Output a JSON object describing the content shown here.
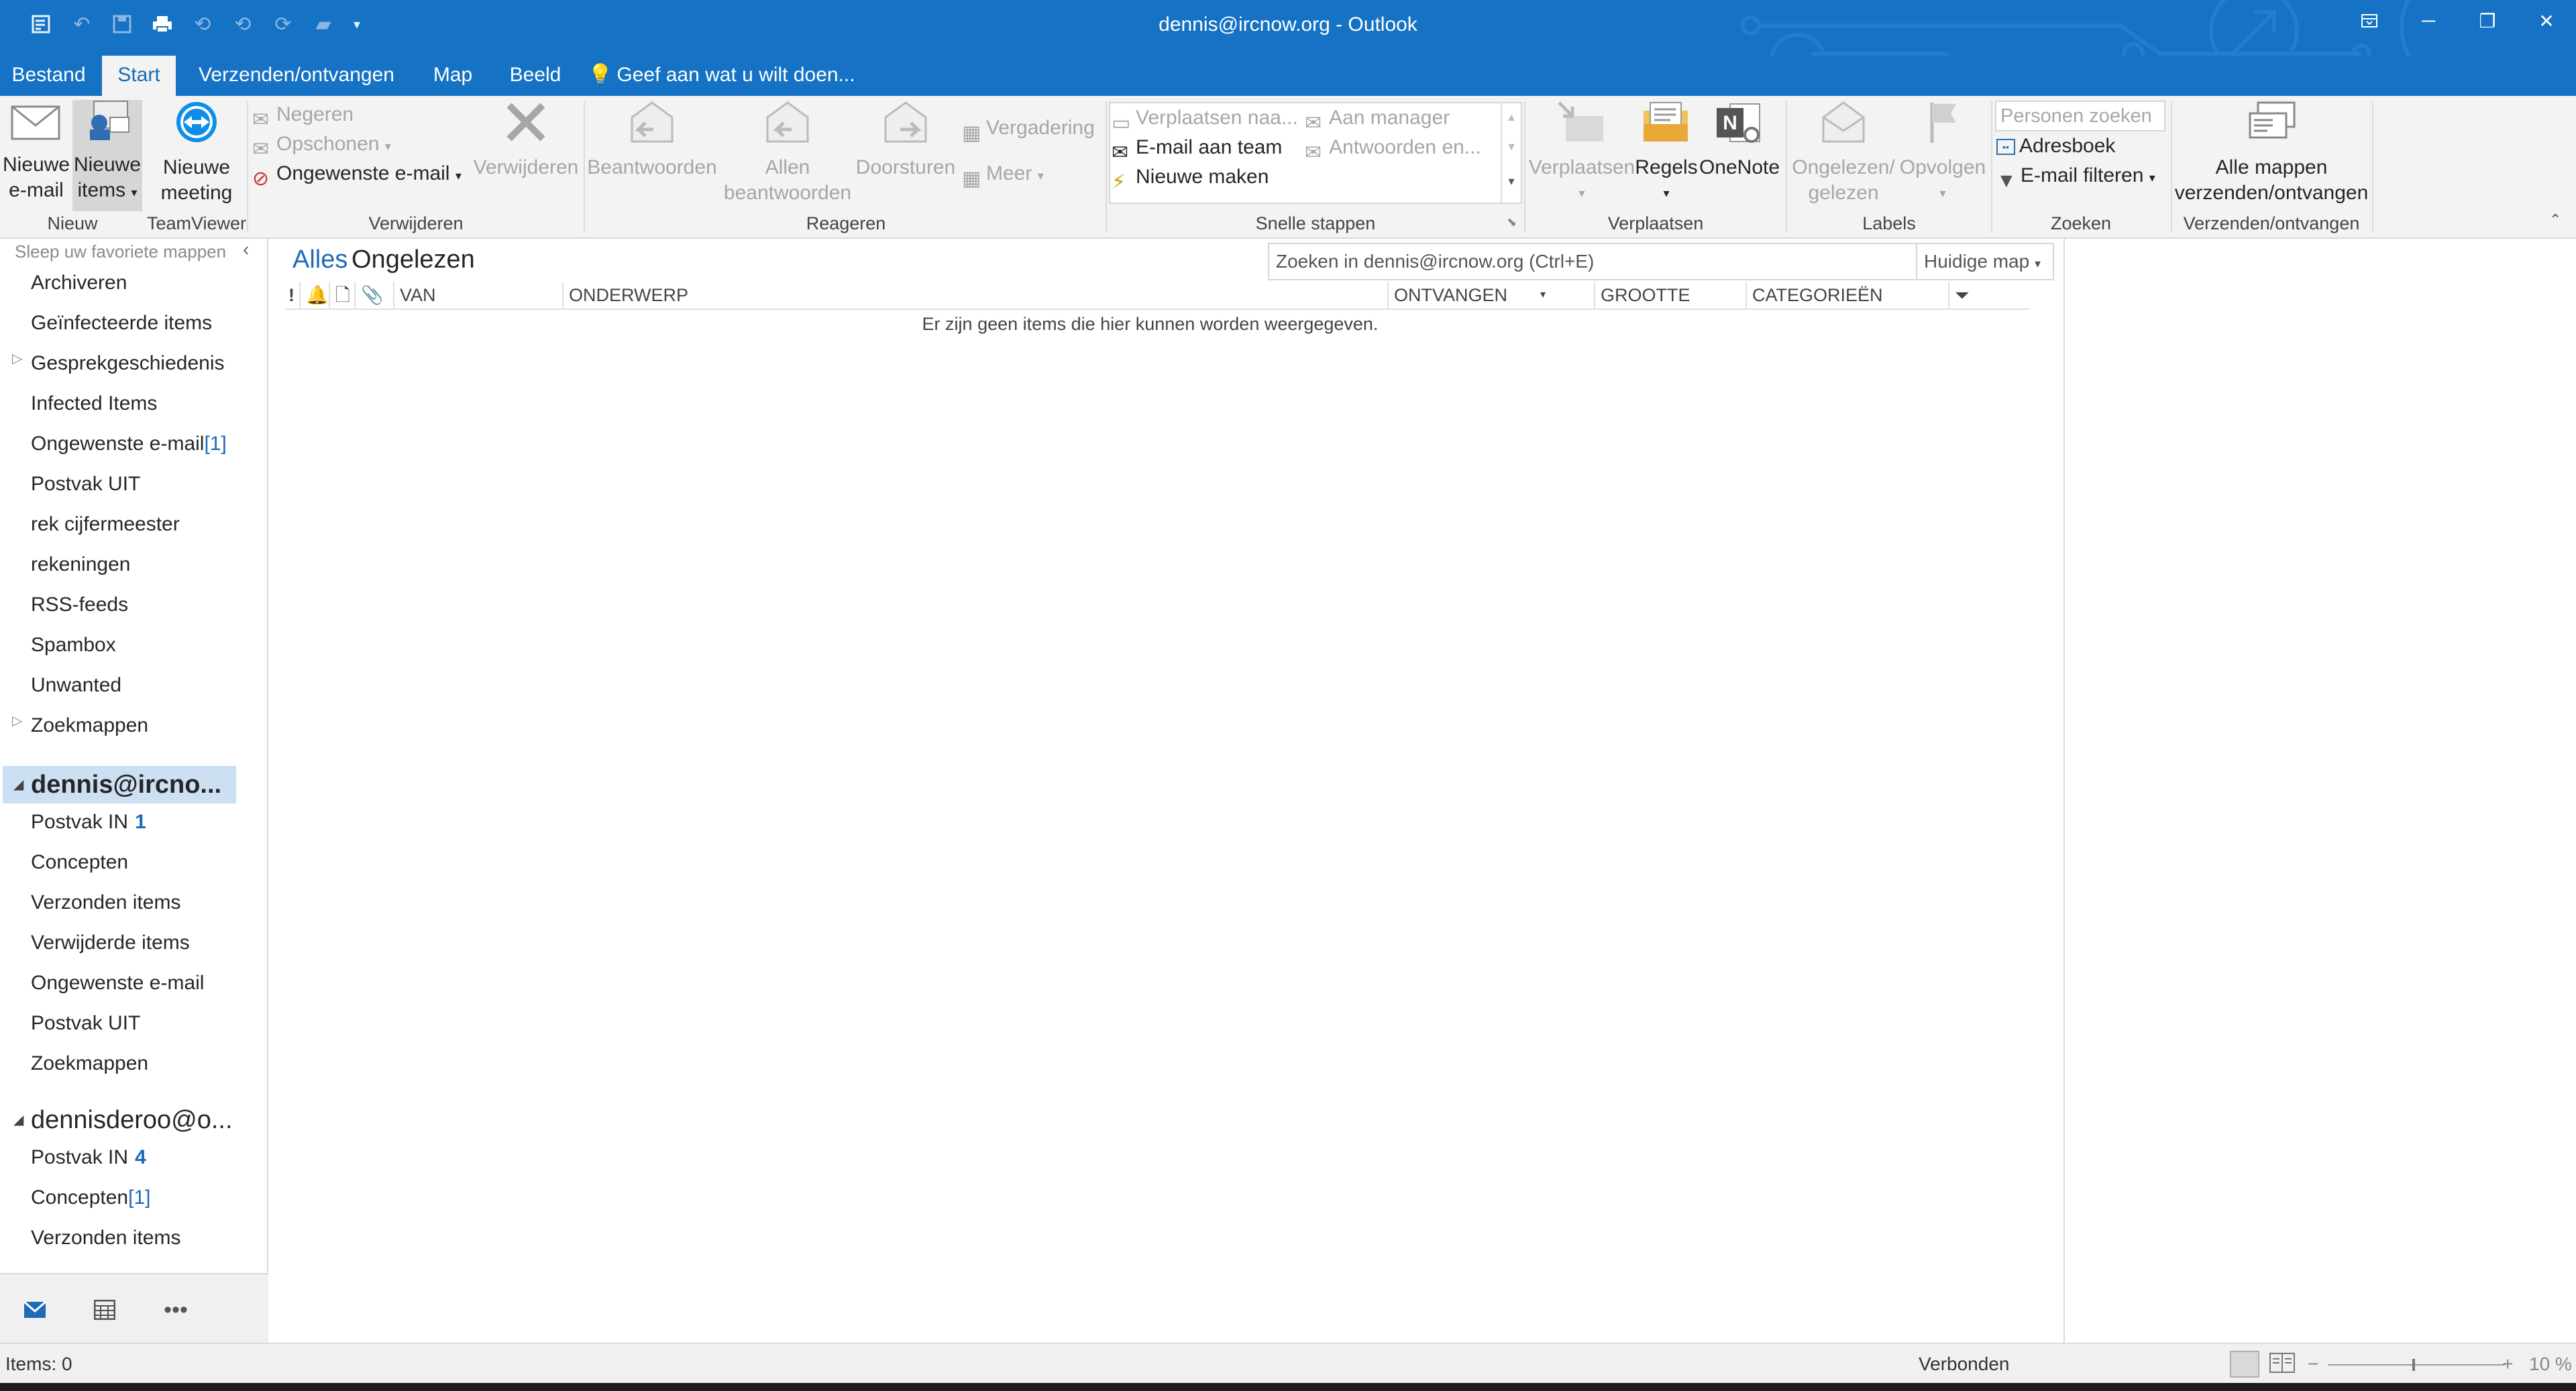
{
  "window": {
    "title": "dennis@ircnow.org - Outlook",
    "accent": "#1572c4"
  },
  "ribbon_tabs": [
    "Bestand",
    "Start",
    "Verzenden/ontvangen",
    "Map",
    "Beeld"
  ],
  "active_tab": "Start",
  "tell_me": "Geef aan wat u wilt doen...",
  "ribbon": {
    "nieuw": {
      "label": "Nieuw",
      "new_email": [
        "Nieuwe",
        "e-mail"
      ],
      "new_items": [
        "Nieuwe",
        "items"
      ]
    },
    "teamviewer": {
      "label": "TeamViewer",
      "new_meeting": [
        "Nieuwe",
        "meeting"
      ]
    },
    "verwijderen": {
      "label": "Verwijderen",
      "ignore": "Negeren",
      "cleanup": "Opschonen",
      "junk": "Ongewenste e-mail",
      "delete": "Verwijderen"
    },
    "reageren": {
      "label": "Reageren",
      "reply": "Beantwoorden",
      "reply_all": [
        "Allen",
        "beantwoorden"
      ],
      "forward": "Doorsturen",
      "meeting": "Vergadering",
      "more": "Meer"
    },
    "snelle_stappen": {
      "label": "Snelle stappen",
      "move_to": "Verplaatsen naa...",
      "to_manager": "Aan manager",
      "team_email": "E-mail aan team",
      "reply_delete": "Antwoorden en...",
      "create_new": "Nieuwe maken"
    },
    "verplaatsen": {
      "label": "Verplaatsen",
      "move": "Verplaatsen",
      "rules": "Regels",
      "onenote": "OneNote"
    },
    "labels": {
      "label": "Labels",
      "unread_read": [
        "Ongelezen/",
        "gelezen"
      ],
      "follow_up": "Opvolgen"
    },
    "zoeken": {
      "label": "Zoeken",
      "search_people": "Personen zoeken",
      "address_book": "Adresboek",
      "filter_email": "E-mail filteren"
    },
    "send_receive": {
      "label": "Verzenden/ontvangen",
      "all_folders": [
        "Alle mappen",
        "verzenden/ontvangen"
      ]
    }
  },
  "folder_pane": {
    "favorites_hint": "Sleep uw favoriete mappen",
    "favorites": [
      {
        "name": "Archiveren"
      },
      {
        "name": "Geïnfecteerde items"
      },
      {
        "name": "Gesprekgeschiedenis"
      },
      {
        "name": "Infected Items"
      },
      {
        "name": "Ongewenste e-mail",
        "count": "[1]"
      },
      {
        "name": "Postvak UIT"
      },
      {
        "name": "rek cijfermeester"
      },
      {
        "name": "rekeningen"
      },
      {
        "name": "RSS-feeds"
      },
      {
        "name": "Spambox"
      },
      {
        "name": "Unwanted"
      },
      {
        "name": "Zoekmappen"
      }
    ],
    "account1": {
      "name": "dennis@ircno...",
      "folders": [
        {
          "name": "Postvak IN",
          "count": "1"
        },
        {
          "name": "Concepten"
        },
        {
          "name": "Verzonden items"
        },
        {
          "name": "Verwijderde items"
        },
        {
          "name": "Ongewenste e-mail"
        },
        {
          "name": "Postvak UIT"
        },
        {
          "name": "Zoekmappen"
        }
      ]
    },
    "account2": {
      "name": "dennisderoo@o...",
      "folders": [
        {
          "name": "Postvak IN",
          "count": "4"
        },
        {
          "name": "Concepten",
          "count": "[1]"
        },
        {
          "name": "Verzonden items"
        }
      ]
    }
  },
  "list": {
    "filter_all": "Alles",
    "filter_unread": "Ongelezen",
    "search_placeholder": "Zoeken in dennis@ircnow.org (Ctrl+E)",
    "scope": "Huidige map",
    "columns": {
      "importance": "!",
      "from": "VAN",
      "subject": "ONDERWERP",
      "received": "ONTVANGEN",
      "size": "GROOTTE",
      "categories": "CATEGORIEËN"
    },
    "empty_message": "Er zijn geen items die hier kunnen worden weergegeven."
  },
  "status": {
    "items": "Items: 0",
    "connection": "Verbonden",
    "zoom_percent": "10 %",
    "zoom_minus": "−",
    "zoom_plus": "+"
  }
}
